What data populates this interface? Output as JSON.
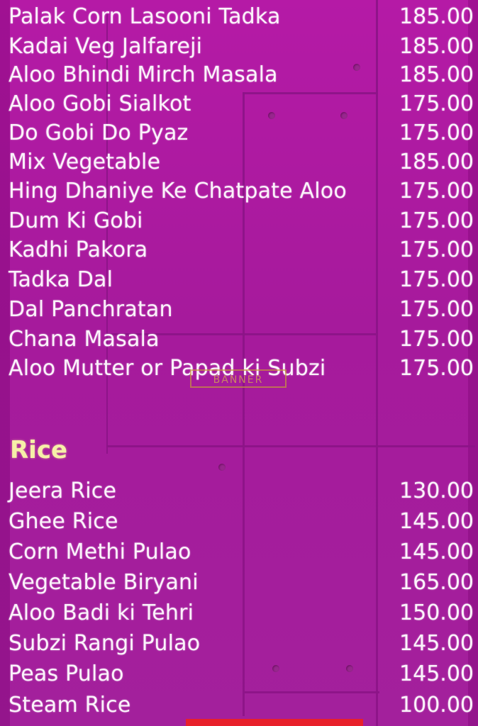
{
  "section_1": {
    "items": [
      {
        "name": "Palak Corn Lasooni Tadka",
        "price": "185.00"
      },
      {
        "name": "Kadai Veg Jalfareji",
        "price": "185.00"
      },
      {
        "name": "Aloo Bhindi Mirch Masala",
        "price": "185.00"
      },
      {
        "name": "Aloo Gobi Sialkot",
        "price": "175.00"
      },
      {
        "name": "Do Gobi Do Pyaz",
        "price": "175.00"
      },
      {
        "name": "Mix Vegetable",
        "price": "185.00"
      },
      {
        "name": "Hing Dhaniye Ke Chatpate Aloo",
        "price": "175.00"
      },
      {
        "name": "Dum Ki Gobi",
        "price": "175.00"
      },
      {
        "name": "Kadhi Pakora",
        "price": "175.00"
      },
      {
        "name": "Tadka Dal",
        "price": "175.00"
      },
      {
        "name": "Dal Panchratan",
        "price": "175.00"
      },
      {
        "name": "Chana Masala",
        "price": "175.00"
      },
      {
        "name": "Aloo Mutter or Papad ki Subzi",
        "price": "175.00"
      }
    ]
  },
  "rice": {
    "heading": "Rice",
    "items": [
      {
        "name": "Jeera Rice",
        "price": "130.00"
      },
      {
        "name": "Ghee Rice",
        "price": "145.00"
      },
      {
        "name": "Corn Methi Pulao",
        "price": "145.00"
      },
      {
        "name": "Vegetable Biryani",
        "price": "165.00"
      },
      {
        "name": "Aloo Badi ki Tehri",
        "price": "150.00"
      },
      {
        "name": "Subzi Rangi Pulao",
        "price": "145.00"
      },
      {
        "name": "Peas Pulao",
        "price": "145.00"
      },
      {
        "name": "Steam Rice",
        "price": "100.00"
      }
    ]
  },
  "watermark": "BANNER",
  "colors": {
    "background": "#a8199d",
    "text": "#fbf3fb",
    "heading": "#f6f0a8"
  }
}
